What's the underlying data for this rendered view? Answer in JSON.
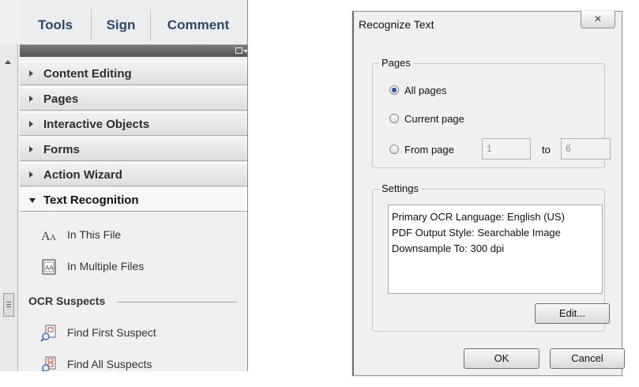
{
  "tools_panel": {
    "tabs": [
      "Tools",
      "Sign",
      "Comment"
    ],
    "sections": [
      {
        "label": "Content Editing",
        "expanded": false
      },
      {
        "label": "Pages",
        "expanded": false
      },
      {
        "label": "Interactive Objects",
        "expanded": false
      },
      {
        "label": "Forms",
        "expanded": false
      },
      {
        "label": "Action Wizard",
        "expanded": false
      },
      {
        "label": "Text Recognition",
        "expanded": true
      }
    ],
    "text_recognition": {
      "items": [
        {
          "label": "In This File",
          "icon": "text-aa-icon"
        },
        {
          "label": "In Multiple Files",
          "icon": "multiple-files-icon"
        }
      ],
      "ocr_heading": "OCR Suspects",
      "ocr_items": [
        {
          "label": "Find First Suspect",
          "icon": "find-suspect-icon"
        },
        {
          "label": "Find All Suspects",
          "icon": "find-all-suspects-icon"
        }
      ]
    }
  },
  "dialog": {
    "title": "Recognize Text",
    "close_glyph": "✕",
    "pages_group": {
      "label": "Pages",
      "options": [
        {
          "label": "All pages",
          "selected": true
        },
        {
          "label": "Current page",
          "selected": false
        },
        {
          "label": "From page",
          "selected": false
        }
      ],
      "from_value": "1",
      "to_label": "to",
      "to_value": "6"
    },
    "settings_group": {
      "label": "Settings",
      "lines": [
        "Primary OCR Language: English (US)",
        "PDF Output Style: Searchable Image",
        "Downsample To: 300 dpi"
      ],
      "edit_button": "Edit..."
    },
    "ok_button": "OK",
    "cancel_button": "Cancel"
  }
}
